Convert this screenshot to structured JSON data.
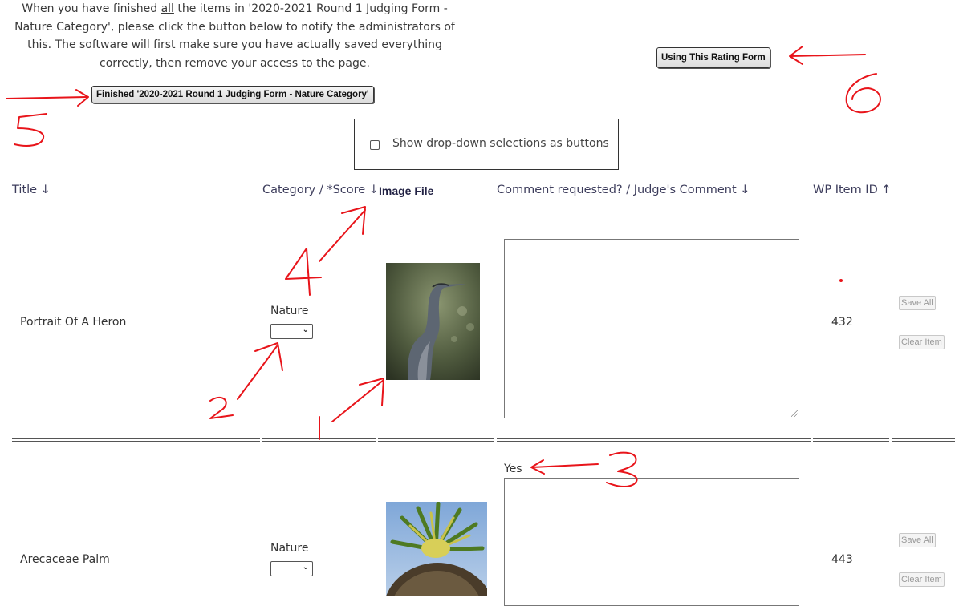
{
  "intro": {
    "line1_pre": "When you have finished ",
    "line1_underlined": "all",
    "line1_post": " the items in '2020-2021 Round 1 Judging Form -",
    "line2": "Nature Category', please click the button below to notify the administrators of",
    "line3": "this. The software will first make sure you have actually saved everything",
    "line4": "correctly, then remove your access to the page."
  },
  "finish_button_label": "Finished '2020-2021 Round 1 Judging Form - Nature Category'",
  "rating_form_button_label": "Using This Rating Form",
  "toggle": {
    "label": "Show drop-down selections as buttons",
    "checked": false
  },
  "table": {
    "headers": {
      "title": "Title ↓",
      "category_score": "Category / *Score ↓",
      "image_file": "Image File",
      "comment": "Comment requested? / Judge's Comment ↓",
      "wp_item_id": "WP Item ID ↑"
    },
    "rows": [
      {
        "title": "Portrait Of A Heron",
        "category": "Nature",
        "score_value": "",
        "comment_requested": "",
        "wp_item_id": "432",
        "save_label": "Save All",
        "clear_label": "Clear Item",
        "image": "heron-photo"
      },
      {
        "title": "Arecaceae Palm",
        "category": "Nature",
        "score_value": "",
        "comment_requested": "Yes",
        "wp_item_id": "443",
        "save_label": "Save All",
        "clear_label": "Clear Item",
        "image": "palm-photo"
      }
    ]
  },
  "annotations": {
    "color": "#e8141a",
    "numbers": [
      "1",
      "2",
      "3",
      "4",
      "5",
      "6"
    ]
  }
}
